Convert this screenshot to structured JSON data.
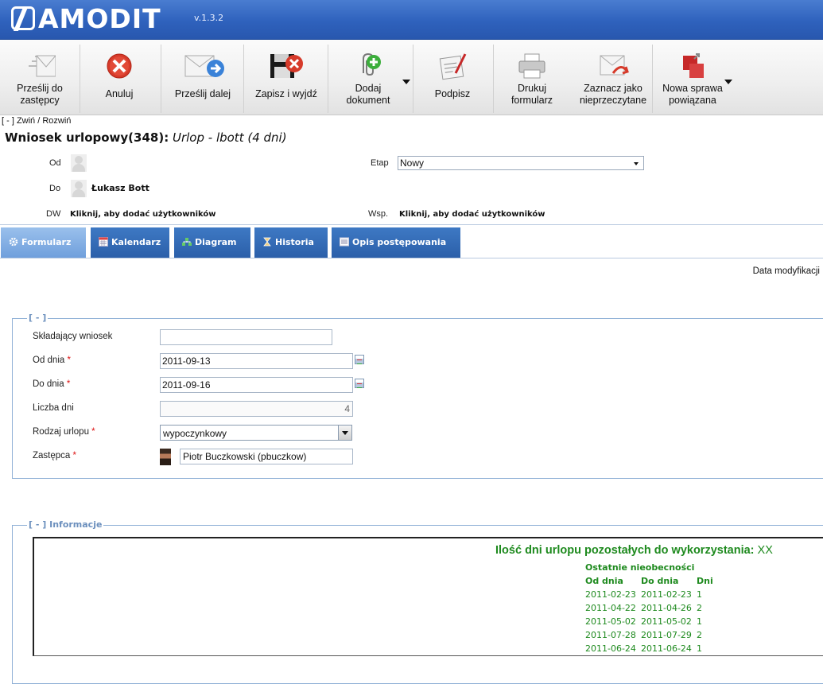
{
  "header": {
    "brand": "AMODIT",
    "version": "v.1.3.2"
  },
  "toolbar": {
    "buttons": [
      {
        "label1": "Prześlij do",
        "label2": "zastępcy"
      },
      {
        "label1": "Anuluj"
      },
      {
        "label1": "Prześlij dalej"
      },
      {
        "label1": "Zapisz i wyjdź"
      },
      {
        "label1": "Dodaj",
        "label2": "dokument"
      },
      {
        "label1": "Podpisz"
      },
      {
        "label1": "Drukuj",
        "label2": "formularz"
      },
      {
        "label1": "Zaznacz jako",
        "label2": "nieprzeczytane"
      },
      {
        "label1": "Nowa sprawa",
        "label2": "powiązana"
      }
    ]
  },
  "collapse": "[ - ] Zwiń / Rozwiń",
  "case": {
    "title_bold": "Wniosek urlopowy(348):",
    "title_italic": "Urlop - lbott (4 dni)"
  },
  "meta": {
    "od_label": "Od",
    "do_label": "Do",
    "do_value": "Łukasz Bott",
    "dw_label": "DW",
    "dw_value": "Kliknij, aby dodać użytkowników",
    "etap_label": "Etap",
    "etap_value": "Nowy",
    "wsp_label": "Wsp.",
    "wsp_value": "Kliknij, aby dodać użytkowników"
  },
  "tabs": [
    "Formularz",
    "Kalendarz",
    "Diagram",
    "Historia",
    "Opis postępowania"
  ],
  "data_modyfikacji": "Data modyfikacji",
  "form": {
    "legend": "[ - ]",
    "skladajacy_label": "Składający wniosek",
    "skladajacy_value": "",
    "od_dnia_label": "Od dnia",
    "od_dnia_value": "2011-09-13",
    "do_dnia_label": "Do dnia",
    "do_dnia_value": "2011-09-16",
    "liczba_dni_label": "Liczba dni",
    "liczba_dni_value": "4",
    "rodzaj_label": "Rodzaj urlopu",
    "rodzaj_value": "wypoczynkowy",
    "zastepca_label": "Zastępca",
    "zastepca_value": "Piotr Buczkowski (pbuczkow)",
    "required_mark": "*"
  },
  "info": {
    "legend": "[ - ] Informacje",
    "title": "Ilość dni urlopu pozostałych do wykorzystania:",
    "title_value": "XX",
    "recent_header": "Ostatnie nieobecności",
    "columns": [
      "Od dnia",
      "Do dnia",
      "Dni"
    ],
    "rows": [
      [
        "2011-02-23",
        "2011-02-23",
        "1"
      ],
      [
        "2011-04-22",
        "2011-04-26",
        "2"
      ],
      [
        "2011-05-02",
        "2011-05-02",
        "1"
      ],
      [
        "2011-07-28",
        "2011-07-29",
        "2"
      ],
      [
        "2011-06-24",
        "2011-06-24",
        "1"
      ]
    ]
  },
  "colors": {
    "header_blue": "#2f62bd",
    "tab_blue": "#2f65ae",
    "tab_active": "#7fa9e0",
    "info_green": "#1e8a1e",
    "required_red": "#d11111"
  }
}
